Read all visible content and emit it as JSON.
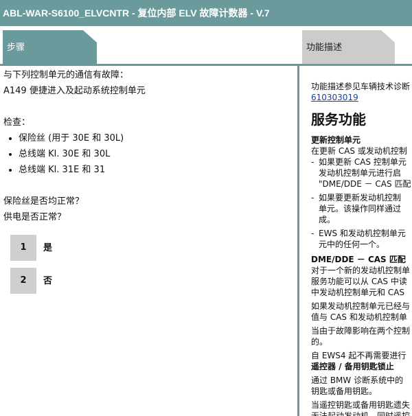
{
  "window": {
    "title": "ABL-WAR-S6100_ELVCNTR - 复位内部 ELV 故障计数器 - V.7"
  },
  "tabs": [
    {
      "label": "步骤",
      "active": true
    },
    {
      "label": "功能描述",
      "active": false
    }
  ],
  "colors": {
    "accent": "#6a9a9b",
    "inactive_tab": "#cccccc",
    "choice_button": "#cfcfcf"
  },
  "steps": {
    "intro_line1": "与下列控制单元的通信有故障：",
    "intro_line2": "A149 便捷进入及起动系统控制单元",
    "check_heading": "检查：",
    "checks": [
      "保险丝 (用于 30E 和 30L)",
      "总线端 Kl. 30E 和 30L",
      "总线端 Kl. 31E 和 31"
    ],
    "question1": "保险丝是否均正常？",
    "question2": "供电是否正常？",
    "choices": [
      {
        "number": "1",
        "label": "是"
      },
      {
        "number": "2",
        "label": "否"
      }
    ]
  },
  "description": {
    "intro": "功能描述参见车辆技术诊断",
    "link": "610303019",
    "heading": "服务功能",
    "section1_title": "更新控制单元",
    "section1_text": "在更新 CAS 或发动机控制",
    "bullets": [
      {
        "line1": "如果更新 CAS 控制单元",
        "line2": "发动机控制单元进行启",
        "line3": "\"DME/DDE － CAS 匹配"
      },
      {
        "line1": "如果要更新发动机控制",
        "line2": "单元。该操作同样通过",
        "line3": "成。"
      },
      {
        "line1": "EWS 和发动机控制单元",
        "line2": "元中的任何一个。",
        "line3": ""
      }
    ],
    "section2_title": "DME/DDE － CAS 匹配",
    "section2_lines": [
      "对于一个新的发动机控制单",
      "服务功能可以从 CAS 中读",
      "中发动机控制单元和 CAS"
    ],
    "section3_lines": [
      "如果发动机控制单元已经与",
      "值与 CAS 和发动机控制单"
    ],
    "section4_lines": [
      "当由于故障影响在两个控制",
      "的。"
    ],
    "section5_line": "自 EWS4 起不再需要进行",
    "section6_title": "遥控器 / 备用钥匙锁止",
    "section6_lines": [
      "通过 BMW 诊断系统中的",
      "钥匙或备用钥匙。"
    ],
    "section7_lines": [
      "当遥控钥匙或备用钥匙遗失",
      "无法起动发动机。同时遥控"
    ]
  }
}
